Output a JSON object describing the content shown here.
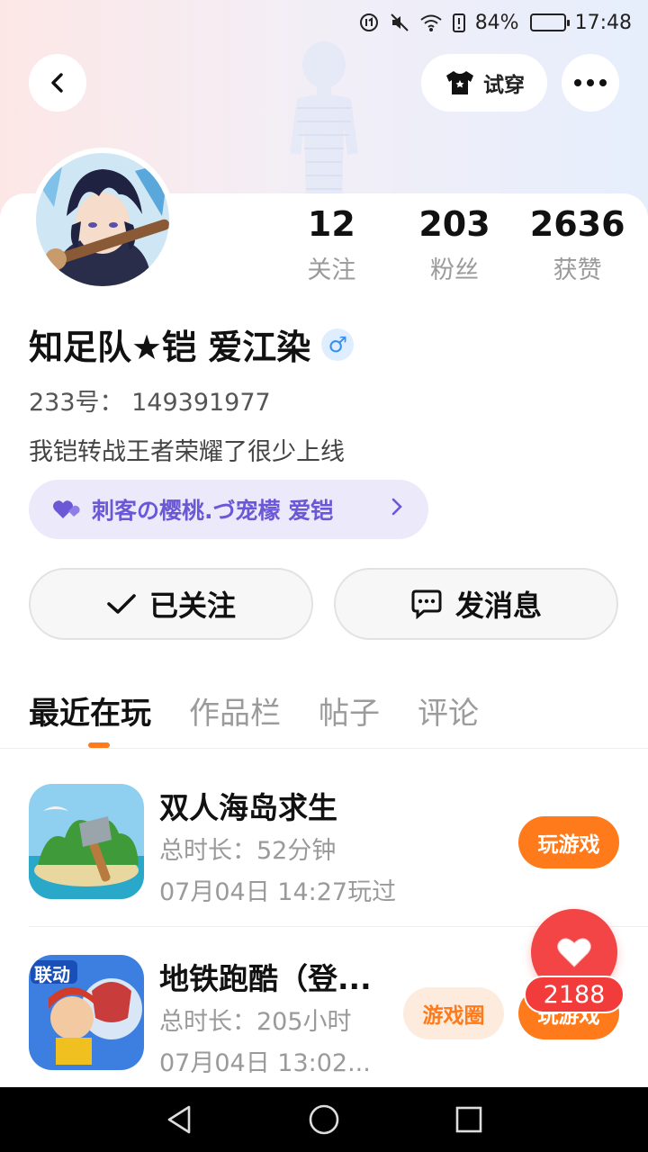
{
  "status_bar": {
    "battery_percent": "84%",
    "time": "17:48",
    "battery_level": 0.84
  },
  "header": {
    "try_on_label": "试穿"
  },
  "profile": {
    "stats": [
      {
        "value": "12",
        "label": "关注"
      },
      {
        "value": "203",
        "label": "粉丝"
      },
      {
        "value": "2636",
        "label": "获赞"
      }
    ],
    "name": "知足队★铠  爱江染",
    "gender_symbol": "♂",
    "uid": "233号：  149391977",
    "bio": "我铠转战王者荣耀了很少上线",
    "cp_tag": "刺客の樱桃.づ宠檬  爱铠",
    "follow_label": "已关注",
    "message_label": "发消息"
  },
  "tabs": [
    "最近在玩",
    "作品栏",
    "帖子",
    "评论"
  ],
  "games": [
    {
      "title": "双人海岛求生",
      "duration": "总时长：52分钟",
      "last_played": "07月04日 14:27玩过",
      "play_label": "玩游戏"
    },
    {
      "title": "地铁跑酷（登...",
      "duration": "总时长：205小时",
      "last_played": "07月04日 13:02...",
      "circle_label": "游戏圈",
      "play_label": "玩游戏",
      "icon_badge": "联动"
    }
  ],
  "like_fab": {
    "count": "2188"
  },
  "colors": {
    "accent": "#ff7a1a",
    "like": "#f34545",
    "cp_text": "#6a58d6",
    "cp_bg": "#ece9fb"
  }
}
